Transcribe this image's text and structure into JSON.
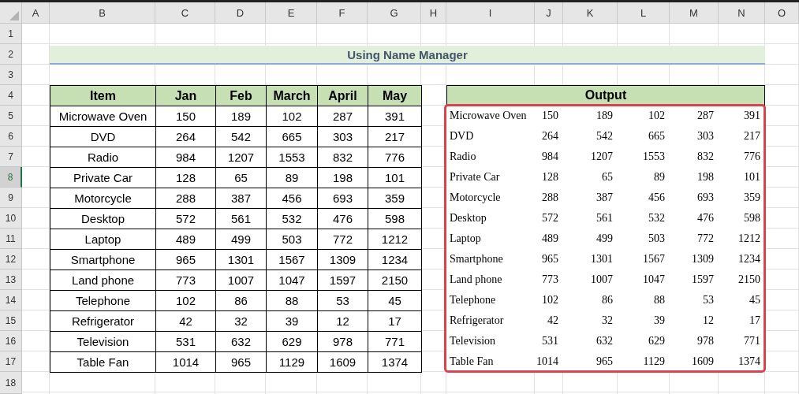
{
  "column_headers": [
    {
      "label": "A",
      "selected": false
    },
    {
      "label": "B",
      "selected": false
    },
    {
      "label": "C",
      "selected": false
    },
    {
      "label": "D",
      "selected": false
    },
    {
      "label": "E",
      "selected": false
    },
    {
      "label": "F",
      "selected": false
    },
    {
      "label": "G",
      "selected": false
    },
    {
      "label": "H",
      "selected": false
    },
    {
      "label": "I",
      "selected": false
    },
    {
      "label": "J",
      "selected": false
    },
    {
      "label": "K",
      "selected": false
    },
    {
      "label": "L",
      "selected": false
    },
    {
      "label": "M",
      "selected": false
    },
    {
      "label": "N",
      "selected": false
    },
    {
      "label": "O",
      "selected": false
    }
  ],
  "row_headers": [
    {
      "label": "1",
      "selected": false
    },
    {
      "label": "2",
      "selected": false
    },
    {
      "label": "3",
      "selected": false
    },
    {
      "label": "4",
      "selected": false
    },
    {
      "label": "5",
      "selected": false
    },
    {
      "label": "6",
      "selected": false
    },
    {
      "label": "7",
      "selected": false
    },
    {
      "label": "8",
      "selected": true
    },
    {
      "label": "9",
      "selected": false
    },
    {
      "label": "10",
      "selected": false
    },
    {
      "label": "11",
      "selected": false
    },
    {
      "label": "12",
      "selected": false
    },
    {
      "label": "13",
      "selected": false
    },
    {
      "label": "14",
      "selected": false
    },
    {
      "label": "15",
      "selected": false
    },
    {
      "label": "16",
      "selected": false
    },
    {
      "label": "17",
      "selected": false
    },
    {
      "label": "18",
      "selected": false
    }
  ],
  "title": "Using Name Manager",
  "table": {
    "columns": [
      "Item",
      "Jan",
      "Feb",
      "March",
      "April",
      "May"
    ],
    "rows": [
      [
        "Microwave Oven",
        "150",
        "189",
        "102",
        "287",
        "391"
      ],
      [
        "DVD",
        "264",
        "542",
        "665",
        "303",
        "217"
      ],
      [
        "Radio",
        "984",
        "1207",
        "1553",
        "832",
        "776"
      ],
      [
        "Private Car",
        "128",
        "65",
        "89",
        "198",
        "101"
      ],
      [
        "Motorcycle",
        "288",
        "387",
        "456",
        "693",
        "359"
      ],
      [
        "Desktop",
        "572",
        "561",
        "532",
        "476",
        "598"
      ],
      [
        "Laptop",
        "489",
        "499",
        "503",
        "772",
        "1212"
      ],
      [
        "Smartphone",
        "965",
        "1301",
        "1567",
        "1309",
        "1234"
      ],
      [
        "Land phone",
        "773",
        "1007",
        "1047",
        "1597",
        "2150"
      ],
      [
        "Telephone",
        "102",
        "86",
        "88",
        "53",
        "45"
      ],
      [
        "Refrigerator",
        "42",
        "32",
        "39",
        "12",
        "17"
      ],
      [
        "Television",
        "531",
        "632",
        "629",
        "978",
        "771"
      ],
      [
        "Table Fan",
        "1014",
        "965",
        "1129",
        "1609",
        "1374"
      ]
    ]
  },
  "output": {
    "header": "Output",
    "rows": [
      [
        "Microwave Oven",
        "150",
        "189",
        "102",
        "287",
        "391"
      ],
      [
        "DVD",
        "264",
        "542",
        "665",
        "303",
        "217"
      ],
      [
        "Radio",
        "984",
        "1207",
        "1553",
        "832",
        "776"
      ],
      [
        "Private Car",
        "128",
        "65",
        "89",
        "198",
        "101"
      ],
      [
        "Motorcycle",
        "288",
        "387",
        "456",
        "693",
        "359"
      ],
      [
        "Desktop",
        "572",
        "561",
        "532",
        "476",
        "598"
      ],
      [
        "Laptop",
        "489",
        "499",
        "503",
        "772",
        "1212"
      ],
      [
        "Smartphone",
        "965",
        "1301",
        "1567",
        "1309",
        "1234"
      ],
      [
        "Land phone",
        "773",
        "1007",
        "1047",
        "1597",
        "2150"
      ],
      [
        "Telephone",
        "102",
        "86",
        "88",
        "53",
        "45"
      ],
      [
        "Refrigerator",
        "42",
        "32",
        "39",
        "12",
        "17"
      ],
      [
        "Television",
        "531",
        "632",
        "629",
        "978",
        "771"
      ],
      [
        "Table Fan",
        "1014",
        "965",
        "1129",
        "1609",
        "1374"
      ]
    ]
  }
}
